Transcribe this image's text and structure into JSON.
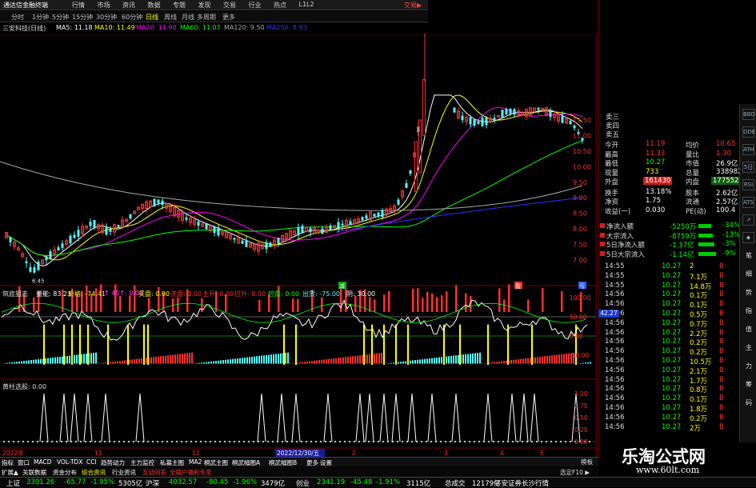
{
  "colors": {
    "up": "#ff3030",
    "down": "#54ffff",
    "grid": "#7a0000",
    "ma5": "#ffffff",
    "ma10": "#ffff00",
    "ma20": "#ff00ff",
    "ma60": "#00ff00",
    "ma120": "#aaaaaa",
    "ma250": "#3030ff"
  },
  "topbar": {
    "app_title": "通达信金融终端",
    "menus": [
      "行情",
      "市场",
      "资讯",
      "数据",
      "专题",
      "发现",
      "交易",
      "行业",
      "热点",
      "L1L2"
    ],
    "account": "交易▶"
  },
  "periods": [
    "分时",
    "1分钟",
    "5分钟",
    "15分钟",
    "30分钟",
    "60分钟",
    "日线",
    "周线",
    "月线",
    "多周期",
    "更多"
  ],
  "ma_bar": {
    "stock_label": "三安科技(日线)",
    "ma5": "MA5: 11.18",
    "ma10": "MA10: 11.49",
    "ma20": "MA20: 11.90",
    "ma60": "MA60: 11.07",
    "ma120": "MA120: 9.50",
    "ma250": "MA250: 8.93"
  },
  "price_axis": [
    "11.50",
    "11.00",
    "10.50",
    "10.00",
    "9.50",
    "9.00",
    "8.50",
    "8.00",
    "7.50",
    "7.00"
  ],
  "low_marker": "6.45",
  "markers": {
    "m1": "减",
    "m2": "盈",
    "m3": "亏"
  },
  "indicator1": {
    "label": "筑底狙击",
    "items": [
      {
        "text": "量能: 83.23",
        "color": "#ffffff"
      },
      {
        "text": "价格: -74.41",
        "color": "#ffff00"
      },
      {
        "text": "↑ 45↑: 0.00",
        "color": "#ff40ff"
      },
      {
        "text": "买盘: 0.00",
        "color": "#ffff00"
      },
      {
        "text": "洗盘: 0.00",
        "color": "#ff3030"
      },
      {
        "text": "主升: 0.00",
        "color": "#ff3030"
      },
      {
        "text": "拉升: 0.00",
        "color": "#ff3030"
      },
      {
        "text": "控盘: 0.00",
        "color": "#00ff00"
      },
      {
        "text": "出货: -75.00",
        "color": "#54ffff"
      },
      {
        "text": "阴: 30.00",
        "color": "#ffffff"
      }
    ],
    "axis": [
      "100.00",
      "50.00",
      "0.00",
      "-50.00"
    ],
    "current_value": "42.27"
  },
  "indicator2": {
    "label": "黄柱选股: 0.00",
    "axis": [
      "1.00",
      "0.75",
      "0.50",
      "0.25",
      "0.00"
    ]
  },
  "date_axis": {
    "label1": "2022年",
    "date_box": "2022/12/30/五",
    "months": [
      "11",
      "12",
      "2",
      "3",
      "4",
      "5"
    ]
  },
  "right_panel": {
    "asks": [
      "卖三",
      "卖四",
      "卖五"
    ],
    "quote": [
      {
        "l1": "今开",
        "v1": "11.19",
        "l2": "均价",
        "v2": "10.65",
        "c1": "#ff3030",
        "c2": "#ff3030"
      },
      {
        "l1": "最高",
        "v1": "11.33",
        "l2": "量比",
        "v2": "1.30",
        "c1": "#ff3030",
        "c2": "#ff3030"
      },
      {
        "l1": "最低",
        "v1": "10.27",
        "l2": "市值",
        "v2": "26.9亿",
        "c1": "#00ff00",
        "c2": "#ffffff"
      },
      {
        "l1": "现量",
        "v1": "733",
        "l2": "总量",
        "v2": "338982",
        "c1": "#ffff00",
        "c2": "#ffffff"
      },
      {
        "l1": "外盘",
        "v1": "161430",
        "l2": "内盘",
        "v2": "177552",
        "c1": "#ff3030",
        "c2": "#00ff00"
      },
      {
        "l1": "换手",
        "v1": "13.18%",
        "l2": "股本",
        "v2": "2.62亿",
        "c1": "#ffffff",
        "c2": "#ffffff"
      },
      {
        "l1": "净资",
        "v1": "1.75",
        "l2": "流通",
        "v2": "2.57亿",
        "c1": "#ffffff",
        "c2": "#ffffff"
      },
      {
        "l1": "收益(一)",
        "v1": "0.030",
        "l2": "PE(动)",
        "v2": "100.4",
        "c1": "#ffffff",
        "c2": "#ffffff"
      }
    ],
    "flows": [
      {
        "label": "净流入额",
        "value": "-5250万",
        "pct": "-34%"
      },
      {
        "label": "大宗流入",
        "value": "-8759万",
        "pct": "-13%"
      },
      {
        "label": "5日净流入额",
        "value": "-1.37亿",
        "pct": "-3%"
      },
      {
        "label": "5日大宗流入",
        "value": "-1.14亿",
        "pct": "-9%"
      }
    ],
    "ticks": [
      {
        "t": "14:55",
        "p": "10.27",
        "v": "2"
      },
      {
        "t": "14:55",
        "p": "10.27",
        "v": "7.1万"
      },
      {
        "t": "14:55",
        "p": "10.27",
        "v": "14.8万"
      },
      {
        "t": "14:56",
        "p": "10.27",
        "v": "0.1万"
      },
      {
        "t": "14:56",
        "p": "10.27",
        "v": "0.1万"
      },
      {
        "t": "14:56",
        "p": "10.27",
        "v": "0.5万"
      },
      {
        "t": "14:56",
        "p": "10.27",
        "v": "0.7万"
      },
      {
        "t": "14:56",
        "p": "10.27",
        "v": "2.2万"
      },
      {
        "t": "14:56",
        "p": "10.27",
        "v": "0.2万"
      },
      {
        "t": "14:56",
        "p": "10.27",
        "v": "0.2万"
      },
      {
        "t": "14:56",
        "p": "10.27",
        "v": "10.5万"
      },
      {
        "t": "14:56",
        "p": "10.27",
        "v": "2.1万"
      },
      {
        "t": "14:56",
        "p": "10.27",
        "v": "1.7万"
      },
      {
        "t": "14:56",
        "p": "10.27",
        "v": "0.8万"
      },
      {
        "t": "14:56",
        "p": "10.27",
        "v": "0.1万"
      },
      {
        "t": "14:56",
        "p": "10.27",
        "v": "1.8万"
      },
      {
        "t": "14:56",
        "p": "10.27",
        "v": "0.2万"
      },
      {
        "t": "14:56",
        "p": "10.27",
        "v": "2万"
      }
    ],
    "tick_side": "B"
  },
  "sidebar": {
    "icons": [
      "BBD",
      "DDE",
      "ATH",
      "5日",
      "RSI",
      "ATS",
      "↗",
      "◆"
    ],
    "buttons": [
      "笔",
      "细",
      "势",
      "指",
      "值",
      "主",
      "力",
      "筹",
      "码"
    ],
    "bottom": "模板"
  },
  "tabs": [
    {
      "text": "指标",
      "color": "#ffffff"
    },
    {
      "text": "窗口",
      "color": "#ffffff"
    },
    {
      "text": "MACD",
      "color": "#ffffff"
    },
    {
      "text": "VOL-TDX",
      "color": "#ffffff"
    },
    {
      "text": "CCI",
      "color": "#ffffff"
    },
    {
      "text": "趋势动力",
      "color": "#ffffff"
    },
    {
      "text": "主力监控",
      "color": "#ffffff"
    },
    {
      "text": "私募主图",
      "color": "#ffffff"
    },
    {
      "text": "MA2",
      "color": "#ffffff"
    },
    {
      "text": "桐武主图",
      "color": "#ffffff"
    },
    {
      "text": "桐武幅图A",
      "color": "#ffffff"
    },
    {
      "text": "桐武幅图B",
      "color": "#ffffff"
    },
    {
      "text": "更多",
      "color": "#ffffff"
    },
    {
      "text": "设置",
      "color": "#ffffff"
    }
  ],
  "tabs2": [
    {
      "text": "扩展▲",
      "color": "#ffffff"
    },
    {
      "text": "关联数据",
      "color": "#ffffff"
    },
    {
      "text": "资金分布",
      "color": "#ffffff"
    },
    {
      "text": "综合资讯",
      "color": "#ffff00"
    },
    {
      "text": "行业资讯",
      "color": "#ffffff"
    },
    {
      "text": "互动问答",
      "color": "#ff3030"
    },
    {
      "text": "全局户福利专享",
      "color": "#ff3030"
    }
  ],
  "mode_label": "选定F10 ▶",
  "index_bar": [
    {
      "text": "上证",
      "color": "#ffffff"
    },
    {
      "text": "3301.26",
      "color": "#00ff00"
    },
    {
      "text": "-65.77",
      "color": "#00ff00"
    },
    {
      "text": "-1.95%",
      "color": "#00ff00"
    },
    {
      "text": "5305亿",
      "color": "#ffffff"
    },
    {
      "text": "沪深",
      "color": "#ffffff"
    },
    {
      "text": "4032.57",
      "color": "#00ff00"
    },
    {
      "text": "-80.45",
      "color": "#00ff00"
    },
    {
      "text": "-1.96%",
      "color": "#00ff00"
    },
    {
      "text": "3479亿",
      "color": "#ffffff"
    },
    {
      "text": "创业",
      "color": "#ffffff"
    },
    {
      "text": "2341.19",
      "color": "#00ff00"
    },
    {
      "text": "-45.48",
      "color": "#00ff00"
    },
    {
      "text": "-1.91%",
      "color": "#00ff00"
    },
    {
      "text": "3115亿",
      "color": "#ffffff"
    },
    {
      "text": "总成交",
      "color": "#ffffff"
    },
    {
      "text": "12179亿",
      "color": "#ffffff"
    },
    {
      "text": "平安证券长沙行情",
      "color": "#ffffff"
    }
  ],
  "watermark": {
    "title": "乐淘公式网",
    "url": "www.60lt.com"
  }
}
